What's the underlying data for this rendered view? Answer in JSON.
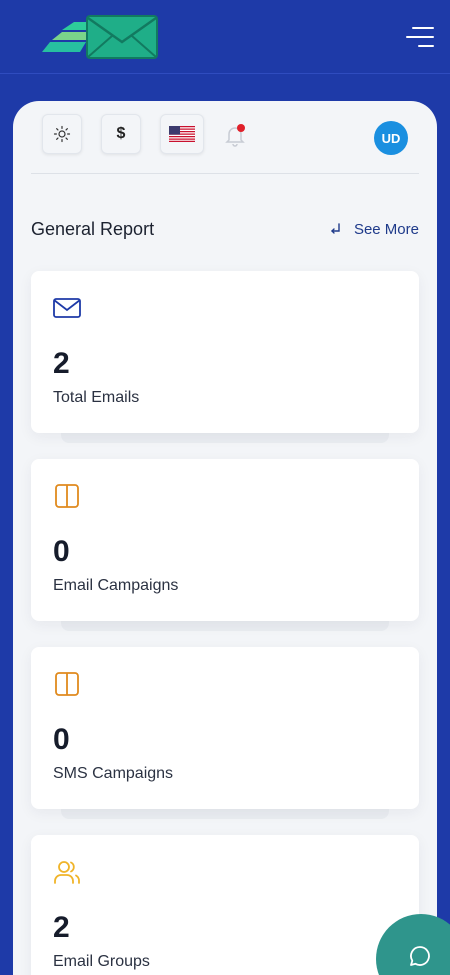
{
  "app": {
    "brand_color": "#1e3aa8",
    "logo_icon": "envelope-logo-icon"
  },
  "header": {
    "menu_icon": "hamburger-menu-icon"
  },
  "toolbar": {
    "theme_icon": "sun-icon",
    "currency_label": "$",
    "language_icon": "us-flag-icon",
    "notification_icon": "bell-icon",
    "avatar_initials": "UD",
    "avatar_color": "#1a8fe0"
  },
  "report": {
    "title": "General Report",
    "see_more_label": "See More",
    "cards": [
      {
        "icon": "envelope-icon",
        "value": "2",
        "label": "Total Emails",
        "icon_color": "#1e3aa8"
      },
      {
        "icon": "columns-icon",
        "value": "0",
        "label": "Email Campaigns",
        "icon_color": "#e08a1e"
      },
      {
        "icon": "columns-icon",
        "value": "0",
        "label": "SMS Campaigns",
        "icon_color": "#e08a1e"
      },
      {
        "icon": "users-icon",
        "value": "2",
        "label": "Email Groups",
        "icon_color": "#f0b429"
      }
    ]
  },
  "chat": {
    "icon": "chat-bubble-icon",
    "color": "#2f958c"
  }
}
